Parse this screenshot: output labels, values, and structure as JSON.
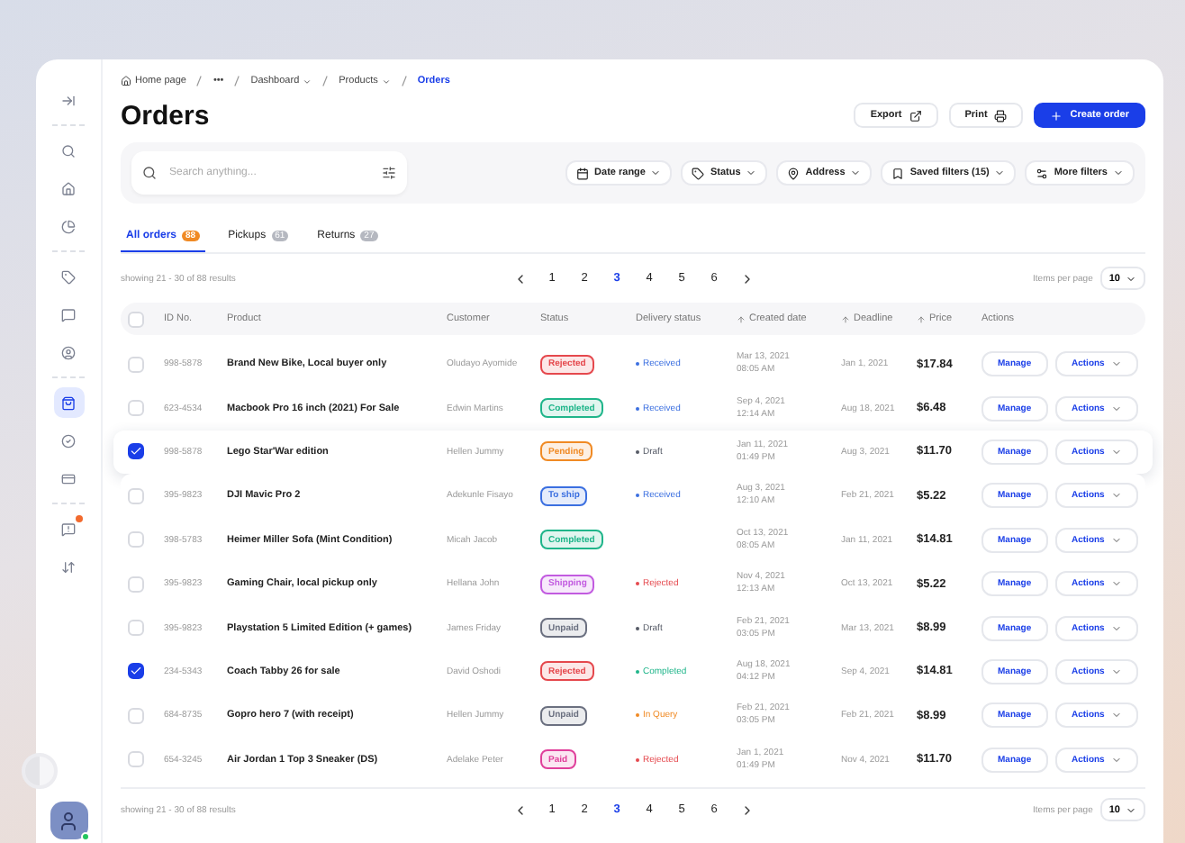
{
  "sidebar": {
    "items": [
      {
        "selected": false,
        "badge": false
      },
      {
        "selected": false,
        "badge": false
      },
      {
        "selected": false,
        "badge": false
      },
      {
        "selected": false,
        "badge": false
      },
      {
        "selected": false,
        "badge": false
      },
      {
        "selected": false,
        "badge": false
      },
      {
        "selected": false,
        "badge": false
      },
      {
        "selected": true,
        "badge": false
      },
      {
        "selected": false,
        "badge": false
      },
      {
        "selected": false,
        "badge": false
      },
      {
        "selected": false,
        "badge": true
      },
      {
        "selected": false,
        "badge": false
      }
    ],
    "avatar": {
      "online": true
    }
  },
  "breadcrumb": [
    {
      "label": "Home page",
      "current": false,
      "dropdown": false
    },
    {
      "label": "•••",
      "current": false,
      "dropdown": false
    },
    {
      "label": "Dashboard",
      "current": false,
      "dropdown": true
    },
    {
      "label": "Products",
      "current": false,
      "dropdown": true
    },
    {
      "label": "Orders",
      "current": true,
      "dropdown": false
    }
  ],
  "title": "Orders",
  "header_buttons": [
    {
      "label": "Export",
      "kind": "export"
    },
    {
      "label": "Print",
      "kind": "print"
    },
    {
      "label": "Create order",
      "kind": "primary"
    }
  ],
  "search": {
    "placeholder": "Search anything..."
  },
  "filters": [
    {
      "label": "Date range",
      "kind": "calendar"
    },
    {
      "label": "Status",
      "kind": "tag"
    },
    {
      "label": "Address",
      "kind": "pin"
    },
    {
      "label": "Saved filters (15)",
      "kind": "bookmark"
    },
    {
      "label": "More filters",
      "kind": "sliders"
    }
  ],
  "tabs": [
    {
      "label": "All orders",
      "count": "88",
      "selected": true
    },
    {
      "label": "Pickups",
      "count": "61",
      "selected": false
    },
    {
      "label": "Returns",
      "count": "27",
      "selected": false
    }
  ],
  "pagination_top": {
    "summary": "showing 21 - 30 of 88 results",
    "pages": [
      {
        "label": "1",
        "selected": false
      },
      {
        "label": "2",
        "selected": false
      },
      {
        "label": "3",
        "selected": true
      },
      {
        "label": "4",
        "selected": false
      },
      {
        "label": "5",
        "selected": false
      },
      {
        "label": "6",
        "selected": false
      }
    ],
    "per_page_label": "Items per page",
    "per_page": "10"
  },
  "table": {
    "all_checked": false,
    "columns": [
      {
        "label": "ID No.",
        "sort": false
      },
      {
        "label": "Product",
        "sort": false
      },
      {
        "label": "Customer",
        "sort": false
      },
      {
        "label": "Status",
        "sort": false
      },
      {
        "label": "Delivery status",
        "sort": false
      },
      {
        "label": "Created date",
        "sort": true
      },
      {
        "label": "Deadline",
        "sort": true
      },
      {
        "label": "Price",
        "sort": true
      },
      {
        "label": "Actions",
        "sort": false
      }
    ],
    "rows": [
      {
        "selected": false,
        "raised": false,
        "id": "998-5878",
        "product": "Brand New Bike, Local buyer only",
        "customer": "Oludayo Ayomide",
        "status": {
          "label": "Rejected",
          "color": "#e5484d"
        },
        "delivery": {
          "label": "Received",
          "color": "#3b6fe0"
        },
        "created": "Mar 13, 2021",
        "created_time": "08:05 AM",
        "deadline": "Jan 1, 2021",
        "price": "$17.84",
        "manage": "Manage",
        "actions": "Actions"
      },
      {
        "selected": false,
        "raised": false,
        "id": "623-4534",
        "product": "Macbook Pro 16 inch (2021) For Sale",
        "customer": "Edwin Martins",
        "status": {
          "label": "Completed",
          "color": "#1fb58a"
        },
        "delivery": {
          "label": "Received",
          "color": "#3b6fe0"
        },
        "created": "Sep 4, 2021",
        "created_time": "12:14 AM",
        "deadline": "Aug 18, 2021",
        "price": "$6.48",
        "manage": "Manage",
        "actions": "Actions"
      },
      {
        "selected": true,
        "raised": true,
        "id": "998-5878",
        "product": "Lego Star'War edition",
        "customer": "Hellen Jummy",
        "status": {
          "label": "Pending",
          "color": "#f08a24"
        },
        "delivery": {
          "label": "Draft",
          "color": "#555a66"
        },
        "created": "Jan 11, 2021",
        "created_time": "01:49 PM",
        "deadline": "Aug 3, 2021",
        "price": "$11.70",
        "manage": "Manage",
        "actions": "Actions"
      },
      {
        "selected": false,
        "raised": false,
        "id": "395-9823",
        "product": "DJI Mavic Pro 2",
        "customer": "Adekunle Fisayo",
        "status": {
          "label": "To ship",
          "color": "#3b6fe0"
        },
        "delivery": {
          "label": "Received",
          "color": "#3b6fe0"
        },
        "created": "Aug 3, 2021",
        "created_time": "12:10 AM",
        "deadline": "Feb 21, 2021",
        "price": "$5.22",
        "manage": "Manage",
        "actions": "Actions"
      },
      {
        "selected": false,
        "raised": false,
        "id": "398-5783",
        "product": "Heimer Miller Sofa (Mint Condition)",
        "customer": "Micah Jacob",
        "status": {
          "label": "Completed",
          "color": "#1fb58a"
        },
        "created": "Oct 13, 2021",
        "created_time": "08:05 AM",
        "deadline": "Jan 11, 2021",
        "price": "$14.81",
        "manage": "Manage",
        "actions": "Actions"
      },
      {
        "selected": false,
        "raised": false,
        "id": "395-9823",
        "product": "Gaming Chair, local pickup only",
        "customer": "Hellana John",
        "status": {
          "label": "Shipping",
          "color": "#c25be0"
        },
        "delivery": {
          "label": "Rejected",
          "color": "#e5484d"
        },
        "created": "Nov 4, 2021",
        "created_time": "12:13 AM",
        "deadline": "Oct 13, 2021",
        "price": "$5.22",
        "manage": "Manage",
        "actions": "Actions"
      },
      {
        "selected": false,
        "raised": false,
        "id": "395-9823",
        "product": "Playstation 5 Limited Edition (+ games)",
        "customer": "James Friday",
        "status": {
          "label": "Unpaid",
          "color": "#6b7080"
        },
        "delivery": {
          "label": "Draft",
          "color": "#555a66"
        },
        "created": "Feb 21, 2021",
        "created_time": "03:05 PM",
        "deadline": "Mar 13, 2021",
        "price": "$8.99",
        "manage": "Manage",
        "actions": "Actions"
      },
      {
        "selected": true,
        "raised": false,
        "id": "234-5343",
        "product": "Coach Tabby 26 for sale",
        "customer": "David Oshodi",
        "status": {
          "label": "Rejected",
          "color": "#e5484d"
        },
        "delivery": {
          "label": "Completed",
          "color": "#1fb58a"
        },
        "created": "Aug 18, 2021",
        "created_time": "04:12 PM",
        "deadline": "Sep 4, 2021",
        "price": "$14.81",
        "manage": "Manage",
        "actions": "Actions"
      },
      {
        "selected": false,
        "raised": false,
        "id": "684-8735",
        "product": "Gopro hero 7 (with receipt)",
        "customer": "Hellen Jummy",
        "status": {
          "label": "Unpaid",
          "color": "#6b7080"
        },
        "delivery": {
          "label": "In Query",
          "color": "#f08a24"
        },
        "created": "Feb 21, 2021",
        "created_time": "03:05 PM",
        "deadline": "Feb 21, 2021",
        "price": "$8.99",
        "manage": "Manage",
        "actions": "Actions"
      },
      {
        "selected": false,
        "raised": false,
        "id": "654-3245",
        "product": "Air Jordan 1 Top 3 Sneaker (DS)",
        "customer": "Adelake Peter",
        "status": {
          "label": "Paid",
          "color": "#e0409b"
        },
        "delivery": {
          "label": "Rejected",
          "color": "#e5484d"
        },
        "created": "Jan 1, 2021",
        "created_time": "01:49 PM",
        "deadline": "Nov 4, 2021",
        "price": "$11.70",
        "manage": "Manage",
        "actions": "Actions"
      }
    ]
  },
  "pagination_bottom": {
    "summary": "showing 21 - 30 of 88 results",
    "pages": [
      {
        "label": "1",
        "selected": false
      },
      {
        "label": "2",
        "selected": false
      },
      {
        "label": "3",
        "selected": true
      },
      {
        "label": "4",
        "selected": false
      },
      {
        "label": "5",
        "selected": false
      },
      {
        "label": "6",
        "selected": false
      }
    ],
    "per_page_label": "Items per page",
    "per_page": "10"
  }
}
